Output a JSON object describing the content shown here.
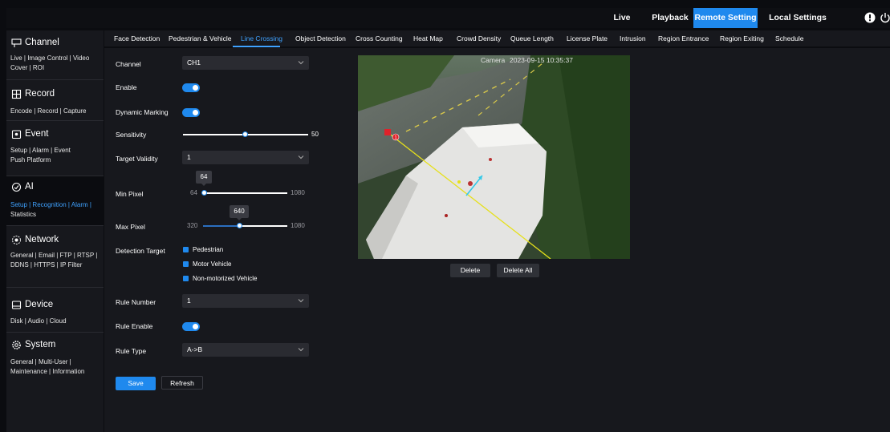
{
  "topbar": {
    "nav": [
      "Live",
      "Playback",
      "Remote Setting",
      "Local Settings"
    ],
    "active": "Remote Setting",
    "icons": [
      "info-icon",
      "power-icon"
    ]
  },
  "sidebar": {
    "sections": [
      {
        "title": "Channel",
        "icon": "channel-icon",
        "links": "Live | Image Control | Video Cover | ROI"
      },
      {
        "title": "Record",
        "icon": "record-icon",
        "links": "Encode | Record | Capture"
      },
      {
        "title": "Event",
        "icon": "event-icon",
        "links": "Setup | Alarm | Event Push Platform"
      },
      {
        "title": "AI",
        "icon": "ai-icon",
        "links_active": "Setup | Recognition | Alarm |",
        "links_rest": "Statistics"
      },
      {
        "title": "Network",
        "icon": "network-icon",
        "links": "General | Email | FTP | RTSP | DDNS | HTTPS | IP Filter"
      },
      {
        "title": "Device",
        "icon": "device-icon",
        "links": "Disk | Audio | Cloud"
      },
      {
        "title": "System",
        "icon": "system-icon",
        "links": "General | Multi-User | Maintenance | Information"
      }
    ]
  },
  "tabs": [
    "Face Detection",
    "Pedestrian & Vehicle",
    "Line Crossing",
    "Object Detection",
    "Cross Counting",
    "Heat Map",
    "Crowd Density",
    "Queue Length",
    "License Plate",
    "Intrusion",
    "Region Entrance",
    "Region Exiting",
    "Schedule"
  ],
  "active_tab": "Line Crossing",
  "form": {
    "channel": {
      "label": "Channel",
      "value": "CH1"
    },
    "enable": {
      "label": "Enable",
      "on": true
    },
    "dynamic_marking": {
      "label": "Dynamic Marking",
      "on": true
    },
    "sensitivity": {
      "label": "Sensitivity",
      "value": "50",
      "fraction": 0.5
    },
    "target_validity": {
      "label": "Target Validity",
      "value": "1"
    },
    "min_pixel": {
      "label": "Min Pixel",
      "min": "64",
      "max": "1080",
      "value": "64"
    },
    "max_pixel": {
      "label": "Max Pixel",
      "min": "320",
      "max": "1080",
      "value": "640"
    },
    "detection_target": {
      "label": "Detection Target",
      "options": [
        "Pedestrian",
        "Motor Vehicle",
        "Non-motorized Vehicle"
      ]
    },
    "rule_number": {
      "label": "Rule Number",
      "value": "1"
    },
    "rule_enable": {
      "label": "Rule Enable",
      "on": true
    },
    "rule_type": {
      "label": "Rule Type",
      "value": "A->B"
    },
    "save": "Save",
    "refresh": "Refresh"
  },
  "video": {
    "camera_label": "Camera",
    "timestamp": "2023-09-15 10:35:37",
    "marker": "1",
    "delete": "Delete",
    "delete_all": "Delete All"
  },
  "colors": {
    "accent": "#1f89ee",
    "line": "#e6e01a",
    "marker": "#e0212a",
    "arrow": "#34c9e8"
  }
}
